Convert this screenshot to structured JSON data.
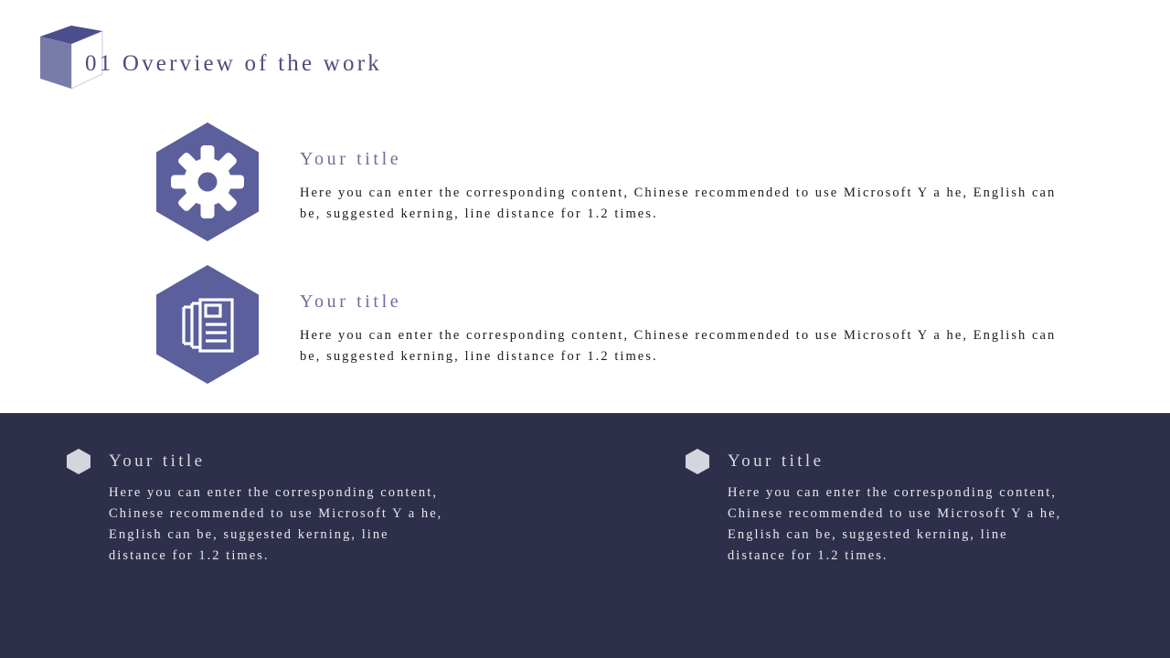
{
  "slide": {
    "background_color": "#ffffff",
    "accent_color": "#5b5f9c",
    "dark_panel_color": "#2e2f4a",
    "heading_color": "#4a4e7a"
  },
  "header": {
    "title": "01 Overview of the work",
    "cube_icon": "cube-icon"
  },
  "features": [
    {
      "icon": "gear-icon",
      "title": "Your title",
      "body": "Here you can enter the corresponding content, Chinese recommended to use Microsoft Y a he, English can be, suggested kerning, line distance for 1.2 times."
    },
    {
      "icon": "documents-icon",
      "title": "Your title",
      "body": "Here you can enter the corresponding content, Chinese recommended to use Microsoft Y a he, English can be, suggested kerning, line distance for 1.2 times."
    }
  ],
  "panel": {
    "columns": [
      {
        "bullet_icon": "hexagon-bullet-icon",
        "title": "Your title",
        "body": "Here you can enter the corresponding content, Chinese recommended to use Microsoft Y a he, English can be, suggested kerning, line distance for 1.2 times."
      },
      {
        "bullet_icon": "hexagon-bullet-icon",
        "title": "Your title",
        "body": "Here you can enter the corresponding content, Chinese recommended to use Microsoft Y a he, English can be, suggested kerning, line distance for 1.2 times."
      }
    ]
  }
}
